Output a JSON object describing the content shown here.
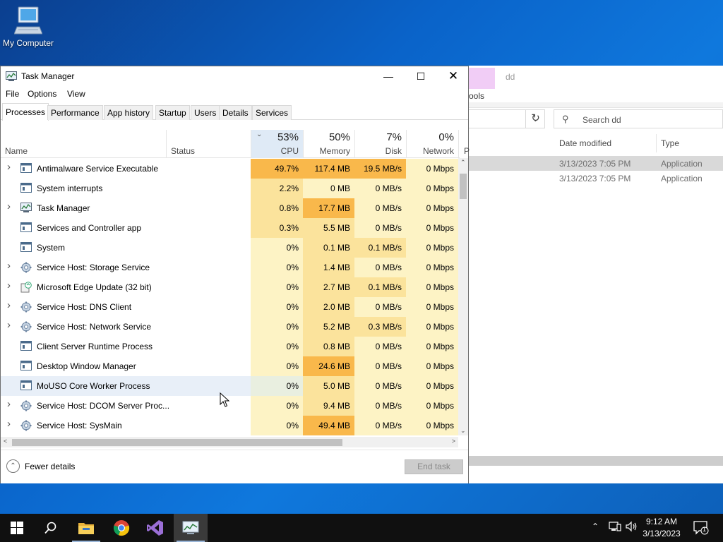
{
  "desktop": {
    "icon_label": "My Computer"
  },
  "explorer": {
    "title": "dd",
    "tools_label": "ools",
    "search_placeholder": "Search dd",
    "columns": [
      "Date modified",
      "Type"
    ],
    "rows": [
      {
        "date": "3/13/2023 7:05 PM",
        "type": "Application"
      },
      {
        "date": "3/13/2023 7:05 PM",
        "type": "Application"
      }
    ]
  },
  "task_manager": {
    "title": "Task Manager",
    "menu": [
      "File",
      "Options",
      "View"
    ],
    "tabs": [
      "Processes",
      "Performance",
      "App history",
      "Startup",
      "Users",
      "Details",
      "Services"
    ],
    "header": {
      "name": "Name",
      "status": "Status",
      "cpu_pct": "53%",
      "cpu": "CPU",
      "mem_pct": "50%",
      "mem": "Memory",
      "disk_pct": "7%",
      "disk": "Disk",
      "net_pct": "0%",
      "net": "Network",
      "more": "P"
    },
    "processes": [
      {
        "name": "Antimalware Service Executable",
        "expand": true,
        "icon": "app-window-icon",
        "cpu": "49.7%",
        "mem": "117.4 MB",
        "disk": "19.5 MB/s",
        "net": "0 Mbps"
      },
      {
        "name": "System interrupts",
        "expand": false,
        "icon": "app-window-icon",
        "cpu": "2.2%",
        "mem": "0 MB",
        "disk": "0 MB/s",
        "net": "0 Mbps"
      },
      {
        "name": "Task Manager",
        "expand": true,
        "icon": "task-manager-icon",
        "cpu": "0.8%",
        "mem": "17.7 MB",
        "disk": "0 MB/s",
        "net": "0 Mbps"
      },
      {
        "name": "Services and Controller app",
        "expand": false,
        "icon": "app-window-icon",
        "cpu": "0.3%",
        "mem": "5.5 MB",
        "disk": "0 MB/s",
        "net": "0 Mbps"
      },
      {
        "name": "System",
        "expand": false,
        "icon": "app-window-icon",
        "cpu": "0%",
        "mem": "0.1 MB",
        "disk": "0.1 MB/s",
        "net": "0 Mbps"
      },
      {
        "name": "Service Host: Storage Service",
        "expand": true,
        "icon": "gear-icon",
        "cpu": "0%",
        "mem": "1.4 MB",
        "disk": "0 MB/s",
        "net": "0 Mbps"
      },
      {
        "name": "Microsoft Edge Update (32 bit)",
        "expand": true,
        "icon": "updater-icon",
        "cpu": "0%",
        "mem": "2.7 MB",
        "disk": "0.1 MB/s",
        "net": "0 Mbps"
      },
      {
        "name": "Service Host: DNS Client",
        "expand": true,
        "icon": "gear-icon",
        "cpu": "0%",
        "mem": "2.0 MB",
        "disk": "0 MB/s",
        "net": "0 Mbps"
      },
      {
        "name": "Service Host: Network Service",
        "expand": true,
        "icon": "gear-icon",
        "cpu": "0%",
        "mem": "5.2 MB",
        "disk": "0.3 MB/s",
        "net": "0 Mbps"
      },
      {
        "name": "Client Server Runtime Process",
        "expand": false,
        "icon": "app-window-icon",
        "cpu": "0%",
        "mem": "0.8 MB",
        "disk": "0 MB/s",
        "net": "0 Mbps"
      },
      {
        "name": "Desktop Window Manager",
        "expand": false,
        "icon": "app-window-icon",
        "cpu": "0%",
        "mem": "24.6 MB",
        "disk": "0 MB/s",
        "net": "0 Mbps"
      },
      {
        "name": "MoUSO Core Worker Process",
        "expand": false,
        "icon": "app-window-icon",
        "cpu": "0%",
        "mem": "5.0 MB",
        "disk": "0 MB/s",
        "net": "0 Mbps",
        "hover": true
      },
      {
        "name": "Service Host: DCOM Server Proc...",
        "expand": true,
        "icon": "gear-icon",
        "cpu": "0%",
        "mem": "9.4 MB",
        "disk": "0 MB/s",
        "net": "0 Mbps"
      },
      {
        "name": "Service Host: SysMain",
        "expand": true,
        "icon": "gear-icon",
        "cpu": "0%",
        "mem": "49.4 MB",
        "disk": "0 MB/s",
        "net": "0 Mbps"
      }
    ],
    "fewer_details": "Fewer details",
    "end_task": "End task"
  },
  "taskbar": {
    "time": "9:12 AM",
    "date": "3/13/2023",
    "notification_count": "1"
  },
  "colors": {
    "heat_high": "#f9b84b",
    "heat_mid": "#fbe39c",
    "heat_low": "#fdf3c5",
    "heat_hover": "#e9efe0",
    "cpu_header": "#dfeaf6"
  }
}
